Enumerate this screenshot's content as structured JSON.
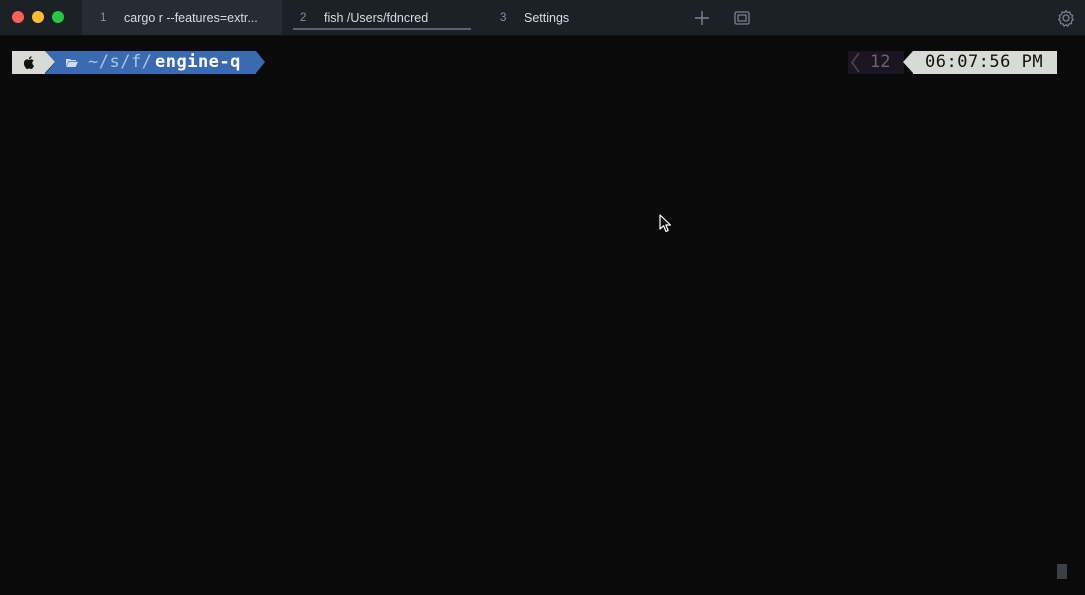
{
  "window": {
    "tabs": [
      {
        "number": "1",
        "title": "cargo r --features=extr..."
      },
      {
        "number": "2",
        "title": "fish /Users/fdncred"
      },
      {
        "number": "3",
        "title": "Settings"
      }
    ]
  },
  "prompt": {
    "path_prefix": "~/s/f/",
    "path_current": "engine-q",
    "status_value": "12",
    "time": "06:07:56 PM"
  },
  "colors": {
    "background": "#0a0a0a",
    "titlebar": "#1c2128",
    "path_segment": "#3a6ab2",
    "light_segment": "#d8dad5"
  },
  "icons": [
    "apple-icon",
    "folder-icon",
    "chevron-left-icon",
    "plus-icon",
    "windows-icon",
    "gear-icon",
    "mouse-cursor-icon"
  ]
}
